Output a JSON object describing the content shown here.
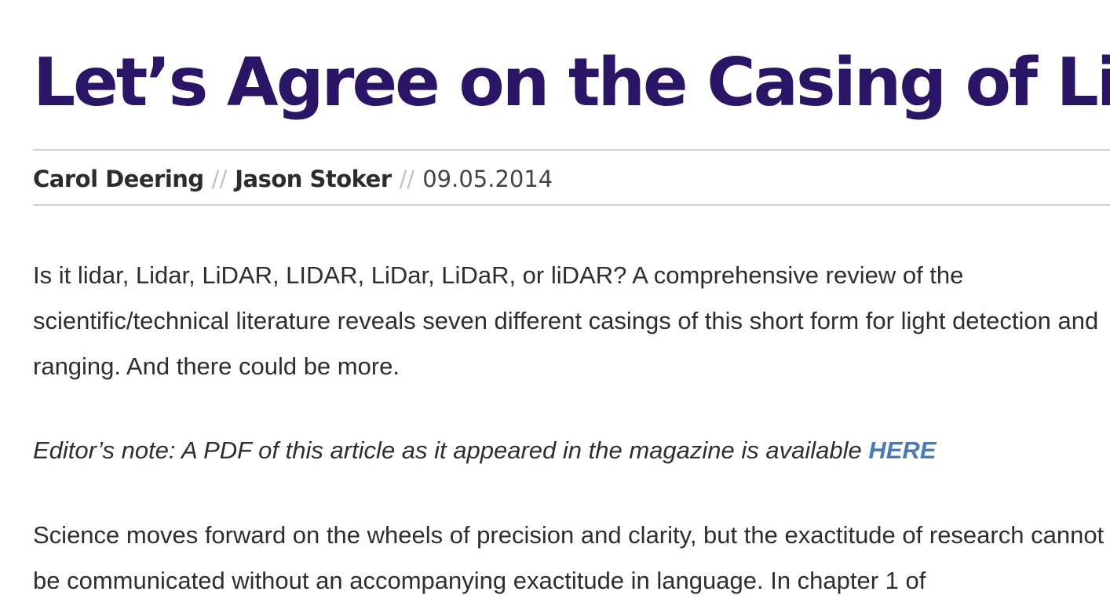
{
  "article": {
    "title": "Let’s Agree on the Casing of Lidar",
    "byline": {
      "author_1": "Carol Deering",
      "author_2": "Jason Stoker",
      "separator": "//",
      "date": "09.05.2014"
    },
    "intro": "Is it lidar, Lidar, LiDAR, LIDAR, LiDar, LiDaR, or liDAR? A comprehensive review of the scientific/technical literature reveals seven different casings of this short form for light detection and ranging. And there could be more.",
    "editor_note": {
      "text": "Editor’s note: A PDF of this article as it appeared in the magazine is available ",
      "link_label": "HERE"
    },
    "body_1": "Science moves forward on the wheels of precision and clarity, but the exactitude of research cannot be communicated without an accompanying exactitude in language. In chapter 1 of"
  },
  "colors": {
    "title": "#2b1567",
    "link": "#4a79b8",
    "text": "#2e2e2e",
    "rule": "#cfcfcf",
    "separator": "#c2c2c2"
  }
}
